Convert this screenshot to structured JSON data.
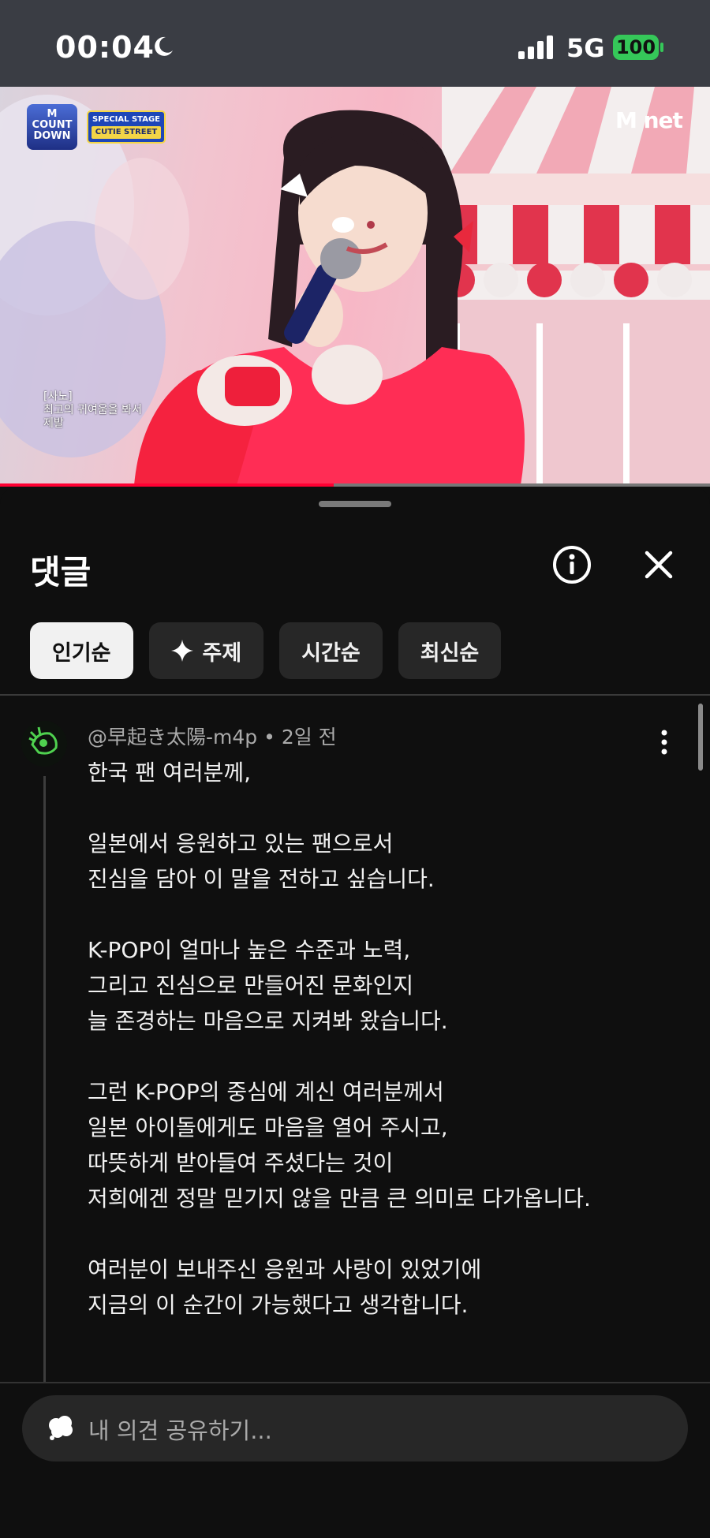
{
  "status_bar": {
    "time": "00:04",
    "network": "5G",
    "battery": "100"
  },
  "video": {
    "logo_count_down": "M COUNT DOWN",
    "special_stage": "SPECIAL STAGE",
    "special_stage_name": "CUTIE STREET",
    "channel_logo": "M net",
    "caption_lines": [
      "[사노]",
      "최고의 귀여움을 봐서",
      "제발"
    ],
    "progress": 0.47
  },
  "sheet": {
    "title": "댓글",
    "chips": [
      {
        "label": "인기순",
        "active": true
      },
      {
        "label": "주제",
        "icon": "sparkle-icon"
      },
      {
        "label": "시간순"
      },
      {
        "label": "최신순"
      }
    ]
  },
  "comment": {
    "author": "@早起き太陽-m4p",
    "time": "2일 전",
    "paragraphs": [
      [
        "한국 팬 여러분께,"
      ],
      [
        "일본에서 응원하고 있는 팬으로서",
        "진심을 담아 이 말을 전하고 싶습니다."
      ],
      [
        "K-POP이 얼마나 높은 수준과 노력,",
        "그리고 진심으로 만들어진 문화인지",
        "늘 존경하는 마음으로 지켜봐 왔습니다."
      ],
      [
        "그런 K-POP의 중심에 계신 여러분께서",
        "일본 아이돌에게도 마음을 열어 주시고,",
        "따뜻하게 받아들여 주셨다는 것이",
        "저희에겐 정말 믿기지 않을 만큼 큰 의미로 다가옵니다."
      ],
      [
        "여러분이 보내주신 응원과 사랑이 있었기에",
        "지금의 이 순간이 가능했다고 생각합니다."
      ]
    ]
  },
  "input": {
    "placeholder": "내 의견 공유하기..."
  }
}
